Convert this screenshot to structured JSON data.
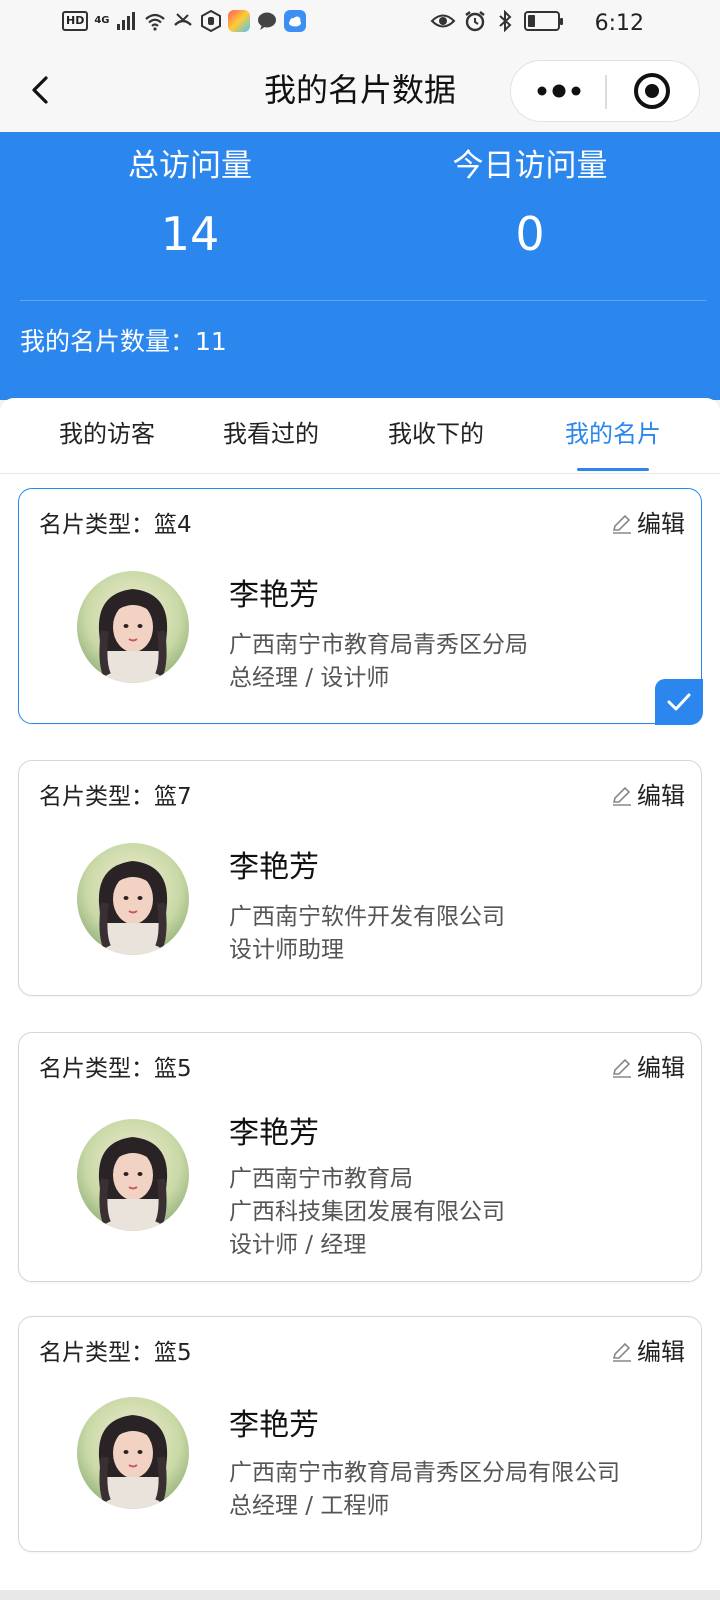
{
  "status_bar": {
    "hd": "HD",
    "network": "4G",
    "time": "6:12"
  },
  "header": {
    "title": "我的名片数据",
    "back_icon": "chevron-left-icon",
    "more_icon": "more-dots-icon",
    "close_icon": "target-circle-icon"
  },
  "stats": {
    "total_label": "总访问量",
    "total_value": "14",
    "today_label": "今日访问量",
    "today_value": "0",
    "card_count": "我的名片数量：11"
  },
  "tabs": [
    {
      "label": "我的访客",
      "active": false
    },
    {
      "label": "我看过的",
      "active": false
    },
    {
      "label": "我收下的",
      "active": false
    },
    {
      "label": "我的名片",
      "active": true
    }
  ],
  "cards": [
    {
      "type": "名片类型：篮4",
      "edit": "编辑",
      "name": "李艳芳",
      "lines": [
        "广西南宁市教育局青秀区分局",
        "总经理 / 设计师"
      ],
      "selected": true
    },
    {
      "type": "名片类型：篮7",
      "edit": "编辑",
      "name": "李艳芳",
      "lines": [
        "广西南宁软件开发有限公司",
        "设计师助理"
      ],
      "selected": false
    },
    {
      "type": "名片类型：篮5",
      "edit": "编辑",
      "name": "李艳芳",
      "lines": [
        "广西南宁市教育局",
        "广西科技集团发展有限公司",
        "设计师 / 经理"
      ],
      "selected": false
    },
    {
      "type": "名片类型：篮5",
      "edit": "编辑",
      "name": "李艳芳",
      "lines": [
        "广西南宁市教育局青秀区分局有限公司",
        "总经理 / 工程师"
      ],
      "selected": false
    }
  ],
  "colors": {
    "accent": "#2b86ee",
    "header_bg": "#2b86ee"
  }
}
